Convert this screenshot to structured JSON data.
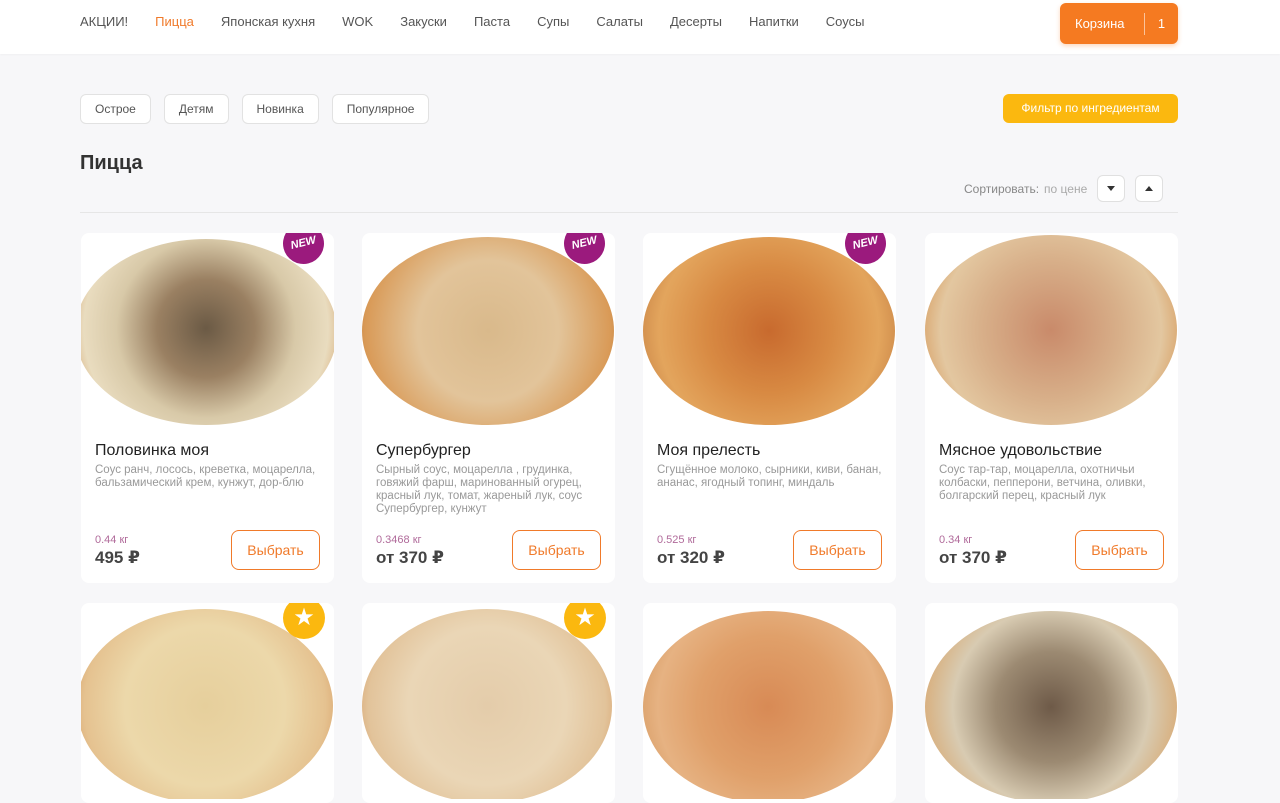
{
  "nav": {
    "items": [
      {
        "label": "АКЦИИ!",
        "active": false
      },
      {
        "label": "Пицца",
        "active": true
      },
      {
        "label": "Японская кухня",
        "active": false
      },
      {
        "label": "WOK",
        "active": false
      },
      {
        "label": "Закуски",
        "active": false
      },
      {
        "label": "Паста",
        "active": false
      },
      {
        "label": "Супы",
        "active": false
      },
      {
        "label": "Салаты",
        "active": false
      },
      {
        "label": "Десерты",
        "active": false
      },
      {
        "label": "Напитки",
        "active": false
      },
      {
        "label": "Соусы",
        "active": false
      }
    ]
  },
  "cart": {
    "label": "Корзина",
    "count": "1"
  },
  "chips": [
    "Острое",
    "Детям",
    "Новинка",
    "Популярное"
  ],
  "filter_button": "Фильтр по ингредиентам",
  "page_title": "Пицца",
  "sort": {
    "label": "Сортировать:",
    "value": "по цене"
  },
  "badges": {
    "new": "NEW",
    "star": "★"
  },
  "colors": {
    "accent": "#f07a2a",
    "cart": "#f57a21",
    "filter": "#fbb80f",
    "badge_new": "#9b1a7d",
    "badge_star": "#fbb80f"
  },
  "products": [
    {
      "name": "Половинка моя",
      "desc": "Соус ранч, лосось, креветка, моцарелла, бальзамический крем, кунжут, дор-блю",
      "weight": "0.44 кг",
      "price": "495 ₽",
      "button": "Выбрать",
      "badge": "new",
      "image": "pizza-half-salmon-shrimp"
    },
    {
      "name": "Супербургер",
      "desc": "Сырный соус, моцарелла , грудинка, говяжий фарш, маринованный огурец, красный лук, томат, жареный лук, соус Супербургер, кунжут",
      "weight": "0.3468 кг",
      "price": "от 370 ₽",
      "button": "Выбрать",
      "badge": "new",
      "image": "pizza-superburger"
    },
    {
      "name": "Моя прелесть",
      "desc": "Сгущённое молоко, сырники, киви, банан, ананас, ягодный топинг, миндаль",
      "weight": "0.525 кг",
      "price": "от 320 ₽",
      "button": "Выбрать",
      "badge": "new",
      "image": "pizza-sweet"
    },
    {
      "name": "Мясное удовольствие",
      "desc": "Соус тар-тар, моцарелла, охотничьи колбаски, пепперони, ветчина, оливки, болгарский перец, красный лук",
      "weight": "0.34 кг",
      "price": "от 370 ₽",
      "button": "Выбрать",
      "badge": "none",
      "image": "pizza-meat"
    },
    {
      "name": "",
      "desc": "",
      "weight": "",
      "price": "",
      "button": "",
      "badge": "star",
      "image": "pizza-chicken"
    },
    {
      "name": "",
      "desc": "",
      "weight": "",
      "price": "",
      "button": "",
      "badge": "star",
      "image": "pizza-olives"
    },
    {
      "name": "",
      "desc": "",
      "weight": "",
      "price": "",
      "button": "",
      "badge": "none",
      "image": "pizza-bbq"
    },
    {
      "name": "",
      "desc": "",
      "weight": "",
      "price": "",
      "button": "",
      "badge": "none",
      "image": "pizza-seafood-balsamic"
    }
  ]
}
